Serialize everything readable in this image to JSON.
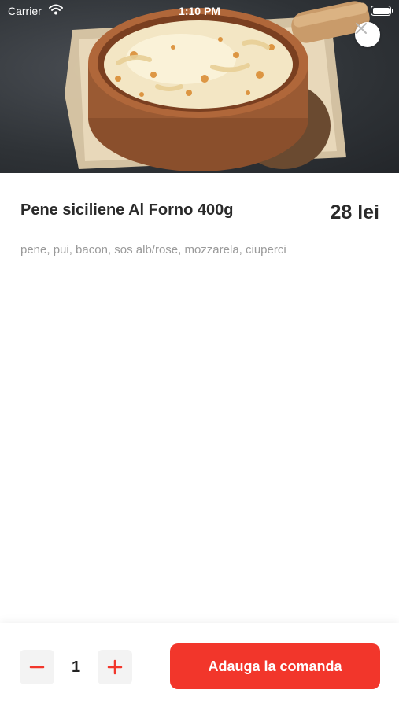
{
  "status_bar": {
    "carrier": "Carrier",
    "time": "1:10 PM"
  },
  "product": {
    "image_icon": "baked-pasta-dish-photo",
    "title": "Pene siciliene Al Forno 400g",
    "price": "28 lei",
    "description": "pene, pui, bacon, sos alb/rose, mozzarela, ciuperci"
  },
  "order_bar": {
    "quantity": "1",
    "add_label": "Adauga la comanda",
    "accent_color": "#f2362b"
  },
  "icons": {
    "close": "close-icon",
    "minus": "minus-icon",
    "plus": "plus-icon",
    "wifi": "wifi-icon",
    "battery": "battery-icon"
  }
}
